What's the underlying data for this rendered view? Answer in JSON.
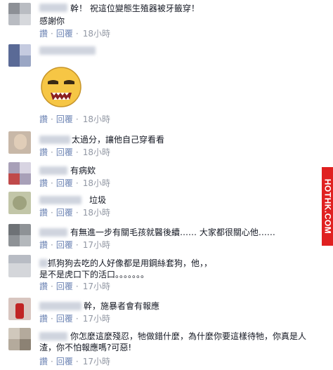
{
  "comments": [
    {
      "text_lines": [
        "幹！ 祝這位變態生殖器被牙籤穿！"
      ],
      "actions": null
    },
    {
      "text_lines": [
        "感謝你"
      ],
      "actions": {
        "read": "讚",
        "reply": "回覆",
        "time": "18小時"
      }
    },
    {
      "sticker": "angry-face-sticker",
      "actions": {
        "read": "讚",
        "reply": "回覆",
        "time": "18小時"
      }
    },
    {
      "text_lines": [
        "太過分，讓他自己穿看看"
      ],
      "actions": {
        "read": "讚",
        "reply": "回覆",
        "time": "18小時"
      }
    },
    {
      "text_lines": [
        "有病欸"
      ],
      "actions": {
        "read": "讚",
        "reply": "回覆",
        "time": "18小時"
      }
    },
    {
      "text_lines": [
        "垃圾"
      ],
      "actions": {
        "read": "讚",
        "reply": "回覆",
        "time": "18小時"
      }
    },
    {
      "text_lines": [
        "有無進一步有關毛孩就醫後續……  大家都很關心他……"
      ],
      "actions": {
        "read": "讚",
        "reply": "回覆",
        "time": "17小時"
      }
    },
    {
      "text_lines": [
        "抓狗狗去吃的人好像都是用鋼絲套狗，他，，",
        "是不是虎口下的活口。。。。。。。"
      ],
      "actions": {
        "read": "讚",
        "reply": "回覆",
        "time": "17小時"
      }
    },
    {
      "text_lines": [
        "幹，施暴者會有報應"
      ],
      "actions": {
        "read": "讚",
        "reply": "回覆",
        "time": "17小時"
      }
    },
    {
      "text_lines": [
        "你怎麼這麼殘忍，牠做錯什麼，為什麼你要這樣待牠，你真是人",
        "渣，你不怕報應嗎?可惡!"
      ],
      "actions": {
        "read": "讚",
        "reply": "回覆",
        "time": "17小時"
      }
    }
  ],
  "watermark": "HOTHK.COM",
  "colors": {
    "link": "#6d84b4",
    "meta": "#9197a3",
    "text": "#141823"
  }
}
